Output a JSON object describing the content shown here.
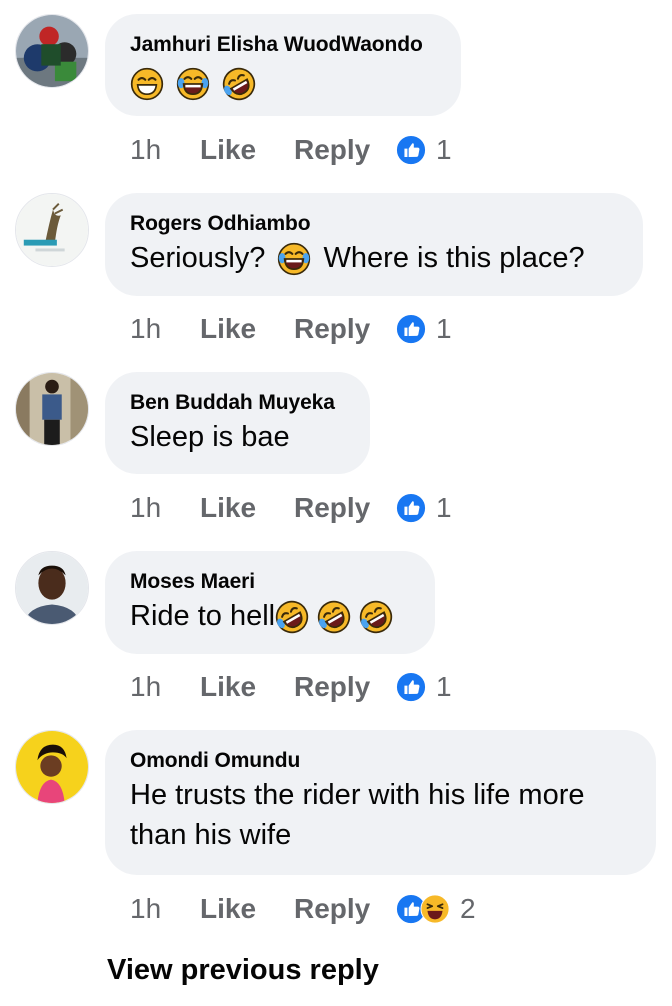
{
  "comments": [
    {
      "author": "Jamhuri Elisha WuodWaondo",
      "text": "",
      "emoji_suffix": [
        "laughing-emoji",
        "tears-of-joy-emoji",
        "rolling-laughing-emoji"
      ],
      "time": "1h",
      "like_label": "Like",
      "reply_label": "Reply",
      "reactions": [
        "like"
      ],
      "reaction_count": "1"
    },
    {
      "author": "Rogers Odhiambo",
      "text_before": "Seriously?",
      "text_after": "Where is this place?",
      "time": "1h",
      "like_label": "Like",
      "reply_label": "Reply",
      "reactions": [
        "like"
      ],
      "reaction_count": "1"
    },
    {
      "author": "Ben Buddah Muyeka",
      "text": "Sleep is bae",
      "time": "1h",
      "like_label": "Like",
      "reply_label": "Reply",
      "reactions": [
        "like"
      ],
      "reaction_count": "1"
    },
    {
      "author": "Moses Maeri",
      "text": "Ride to hell",
      "emoji_suffix": [
        "rolling-laughing-emoji",
        "rolling-laughing-emoji",
        "rolling-laughing-emoji"
      ],
      "time": "1h",
      "like_label": "Like",
      "reply_label": "Reply",
      "reactions": [
        "like"
      ],
      "reaction_count": "1"
    },
    {
      "author": "Omondi Omundu",
      "text_line1": "He trusts the rider with his life more",
      "text_line2": "than his wife",
      "time": "1h",
      "like_label": "Like",
      "reply_label": "Reply",
      "reactions": [
        "like",
        "haha"
      ],
      "reaction_count": "2"
    }
  ],
  "view_previous_reply": "View previous reply",
  "colors": {
    "bubble": "#f0f2f5",
    "meta": "#65676b",
    "like_blue": "#1877f2",
    "emoji_yellow": "#f7b928"
  }
}
